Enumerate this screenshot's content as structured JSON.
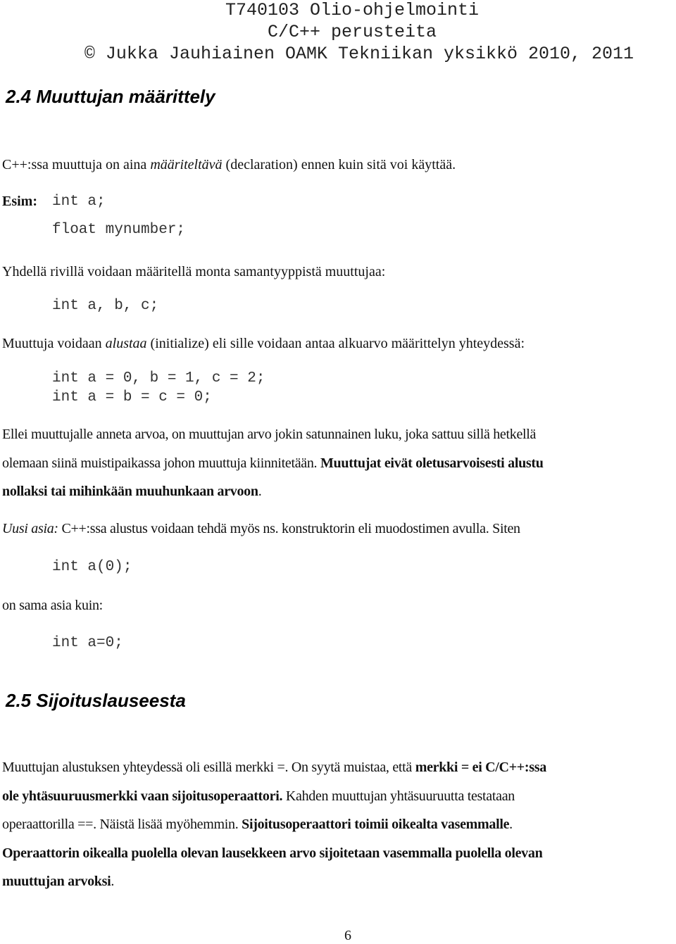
{
  "header": {
    "course": "T740103 Olio-ohjelmointi",
    "subtitle": "C/C++ perusteita",
    "copyright": "© Jukka Jauhiainen OAMK Tekniikan yksikkö 2010, 2011"
  },
  "section_24": {
    "heading": "2.4 Muuttujan määrittely",
    "intro": {
      "pre": "C++:ssa muuttuja on aina ",
      "em": "määriteltävä",
      "post": " (declaration) ennen kuin sitä voi käyttää."
    },
    "example_label": "Esim:",
    "example_code": [
      "int a;",
      "float mynumber;"
    ],
    "multi_decl_text": "Yhdellä rivillä voidaan määritellä monta samantyyppistä muuttujaa:",
    "multi_decl_code": "int a, b, c;",
    "init_text": {
      "pre": "Muuttuja voidaan ",
      "em": "alustaa",
      "post": " (initialize) eli sille voidaan antaa alkuarvo määrittelyn yhteydessä:"
    },
    "init_code": [
      "int a = 0, b = 1, c = 2;",
      "int a = b = c = 0;"
    ],
    "uninit_para": {
      "line1": "Ellei muuttujalle anneta arvoa, on muuttujan arvo jokin satunnainen luku, joka sattuu sillä hetkellä",
      "line2_plain": "olemaan siinä muistipaikassa johon muuttuja kiinnitetään. ",
      "line2_bold": "Muuttujat eivät oletusarvoisesti alustu",
      "line3_bold": "nollaksi tai mihinkään muuhunkaan arvoon",
      "line3_end": "."
    },
    "new_thing": {
      "label": "Uusi asia:",
      "text": " C++:ssa alustus voidaan tehdä myös ns. konstruktorin eli muodostimen avulla. Siten"
    },
    "ctor_code": "int a(0);",
    "same_as_text": "on sama asia kuin:",
    "assign_code": "int a=0;"
  },
  "section_25": {
    "heading": "2.5 Sijoituslauseesta",
    "line1_plain": "Muuttujan alustuksen yhteydessä oli esillä merkki =. On syytä muistaa, että ",
    "line1_bold": "merkki = ei C/C++:ssa",
    "line2_bold": "ole yhtäsuuruusmerkki vaan sijoitusoperaattori.",
    "line2_plain": " Kahden muuttujan yhtäsuuruutta testataan",
    "line3_plain": "operaattorilla ==. Näistä lisää myöhemmin. ",
    "line3_bold": "Sijoitusoperaattori toimii oikealta vasemmalle",
    "line3_end": ".",
    "line4_bold": "Operaattorin oikealla puolella olevan lausekkeen arvo sijoitetaan vasemmalla puolella olevan",
    "line5_bold": "muuttujan arvoksi",
    "line5_end": "."
  },
  "footer": {
    "page_number": "6"
  }
}
